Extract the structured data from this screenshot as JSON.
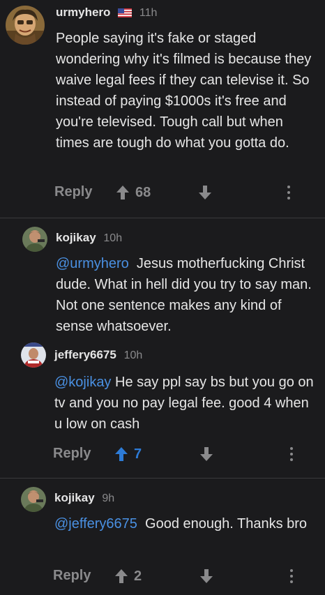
{
  "comments": [
    {
      "username": "urmyhero",
      "time": "11h",
      "text": "People saying it's fake or staged wondering why it's filmed is because they waive legal fees if they can televise it. So instead of paying $1000s it's free and you're televised. Tough call but when times are tough do what you gotta do.",
      "reply_label": "Reply",
      "votes": "68",
      "upvoted": false
    },
    {
      "username": "kojikay",
      "time": "10h",
      "mention": "@urmyhero",
      "text": "Jesus motherfucking Christ dude.  What in hell did you try to say man. Not one sentence makes any kind of sense whatsoever."
    },
    {
      "username": "jeffery6675",
      "time": "10h",
      "mention": "@kojikay",
      "text": "He say ppl say bs but you go on tv and you no pay legal fee. good 4 when u low on cash",
      "reply_label": "Reply",
      "votes": "7",
      "upvoted": true
    },
    {
      "username": "kojikay",
      "time": "9h",
      "mention": "@jeffery6675",
      "text": "Good enough. Thanks bro",
      "reply_label": "Reply",
      "votes": "2",
      "upvoted": false
    }
  ],
  "icons": {
    "upvote": "arrow-up-icon",
    "downvote": "arrow-down-icon",
    "more": "more-vertical-icon",
    "flag": "us-flag-icon"
  },
  "colors": {
    "background": "#1b1b1d",
    "text": "#e6e6e6",
    "muted": "#8a8a8c",
    "mention": "#4a90e2",
    "upvote_active": "#2d7bd6",
    "divider": "#3a3a3c"
  }
}
